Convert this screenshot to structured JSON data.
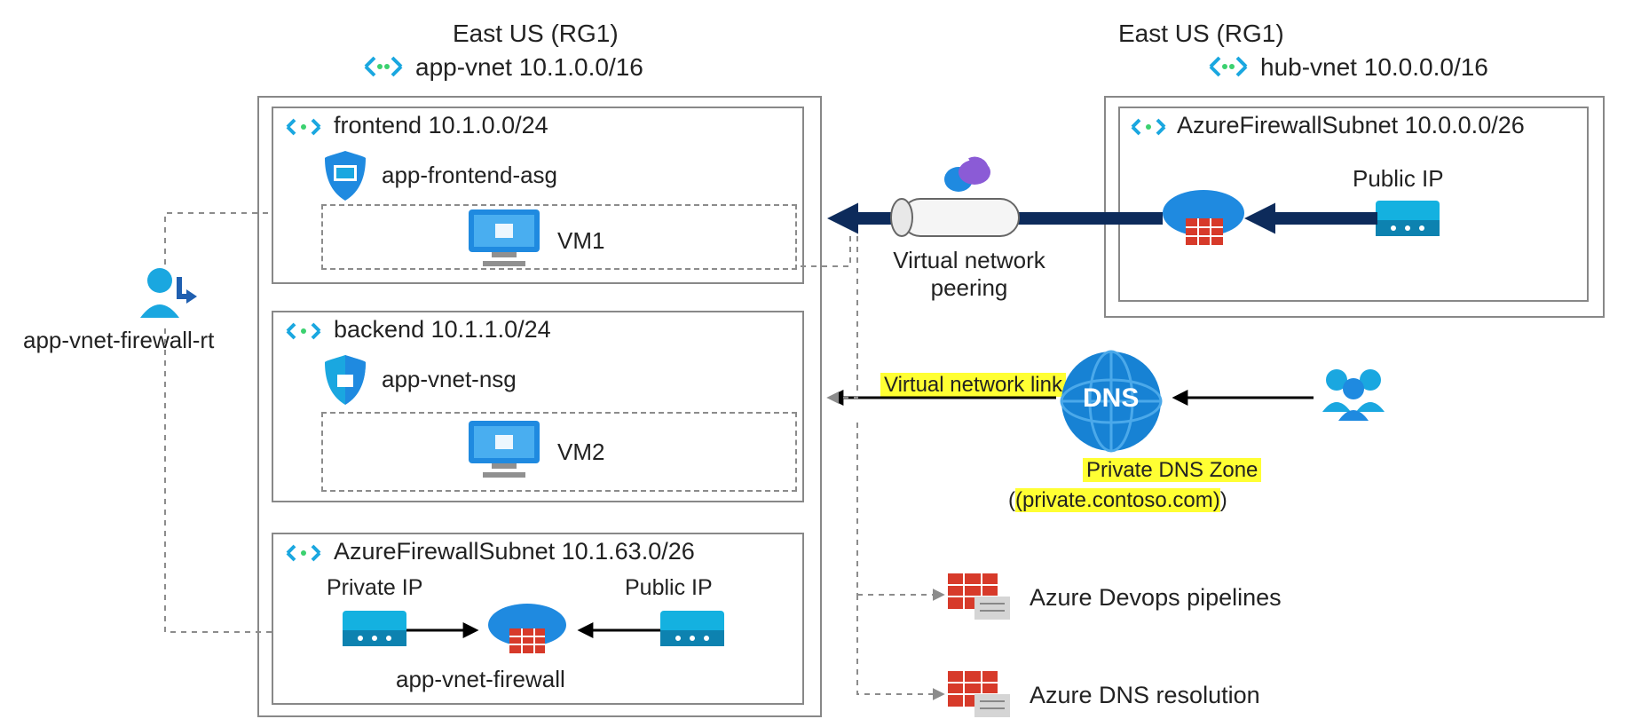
{
  "regions": {
    "left_region": "East US (RG1)",
    "right_region": "East US (RG1)"
  },
  "vnets": {
    "app_vnet": "app-vnet 10.1.0.0/16",
    "hub_vnet": "hub-vnet 10.0.0.0/16"
  },
  "subnets": {
    "frontend": "frontend 10.1.0.0/24",
    "backend": "backend 10.1.1.0/24",
    "app_fw": "AzureFirewallSubnet 10.1.63.0/26",
    "hub_fw": "AzureFirewallSubnet 10.0.0.0/26"
  },
  "resources": {
    "asg": "app-frontend-asg",
    "vm1": "VM1",
    "nsg": "app-vnet-nsg",
    "vm2": "VM2",
    "private_ip": "Private IP",
    "public_ip_left": "Public IP",
    "app_fw_name": "app-vnet-firewall",
    "public_ip_right": "Public IP",
    "route_table": "app-vnet-firewall-rt"
  },
  "connections": {
    "peering": "Virtual network peering",
    "vnet_link": "Virtual network link"
  },
  "dns": {
    "zone_label_1": "Private DNS Zone",
    "zone_label_2": "(private.contoso.com)",
    "circle": "DNS"
  },
  "services": {
    "devops": "Azure Devops pipelines",
    "dns_res": "Azure DNS resolution"
  }
}
